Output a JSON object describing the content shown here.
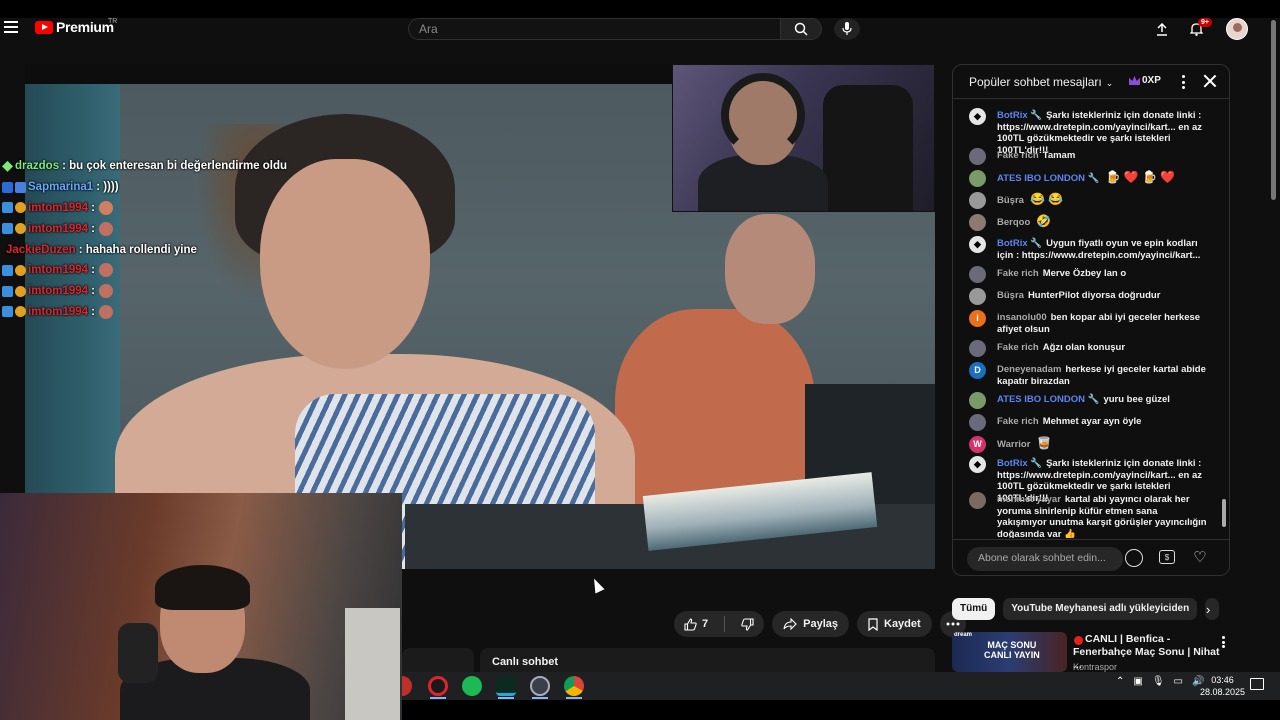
{
  "header": {
    "logo_text": "Premium",
    "logo_suffix": "TR",
    "search_placeholder": "Ara",
    "notification_count": "9+"
  },
  "overlay_chat": [
    {
      "user": "drazdos",
      "user_color": "#7fe87a",
      "message": ": bu çok enteresan bi değerlendirme oldu"
    },
    {
      "user": "Sapmarina1",
      "user_color": "#6aa6ff",
      "message": ": ))))"
    },
    {
      "user": "imtom1994",
      "user_color": "#e0242c",
      "message": ":"
    },
    {
      "user": "imtom1994",
      "user_color": "#e0242c",
      "message": ":"
    },
    {
      "user": "JackieDuzen",
      "user_color": "#e0242c",
      "message": ": hahaha rollendi yine"
    },
    {
      "user": "imtom1994",
      "user_color": "#e0242c",
      "message": ":"
    },
    {
      "user": "imtom1994",
      "user_color": "#e0242c",
      "message": ":"
    },
    {
      "user": "imtom1994",
      "user_color": "#e0242c",
      "message": ":"
    }
  ],
  "actions": {
    "like_count": "7",
    "share_label": "Paylaş",
    "save_label": "Kaydet"
  },
  "live_chat_label": "Canlı sohbet",
  "chat": {
    "title": "Popüler sohbet mesajları",
    "xp": "0XP",
    "input_placeholder": "Abone olarak sohbet edin...",
    "money_icon_label": "$",
    "messages": [
      {
        "name": "BotRix 🔧",
        "text": "Şarkı istekleriniz için donate linki : https://www.dretepin.com/yayinci/kart... en az 100TL gözükmektedir ve şarkı istekleri 100TL'dir!!!"
      },
      {
        "name": "Fake rich",
        "text": "Tamam"
      },
      {
        "name": "ATES IBO LONDON 🔧",
        "text": "🍺 ❤️ 🍺 ❤️"
      },
      {
        "name": "Büşra",
        "text": "😂 😂"
      },
      {
        "name": "Berqoo",
        "text": "🤣"
      },
      {
        "name": "BotRix 🔧",
        "text": "Uygun fiyatlı oyun ve epin kodları için : https://www.dretepin.com/yayinci/kart..."
      },
      {
        "name": "Fake rich",
        "text": "Merve Özbey lan o"
      },
      {
        "name": "Büşra",
        "text": "HunterPilot diyorsa doğrudur"
      },
      {
        "name": "insanolu00",
        "text": "ben kopar abi iyi geceler herkese afiyet olsun"
      },
      {
        "name": "Fake rich",
        "text": "Ağzı olan konuşur"
      },
      {
        "name": "Deneyenadam",
        "text": "herkese iyi geceler kartal abide kapatır birazdan"
      },
      {
        "name": "ATES IBO LONDON 🔧",
        "text": "yuru bee güzel"
      },
      {
        "name": "Fake rich",
        "text": "Mehmet ayar ayn öyle"
      },
      {
        "name": "Warrior",
        "text": "🥃"
      },
      {
        "name": "BotRix 🔧",
        "text": "Şarkı istekleriniz için donate linki : https://www.dretepin.com/yayinci/kart... en az 100TL gözükmektedir ve şarkı istekleri 100TL'dir!!!"
      },
      {
        "name": "mehmet yayar",
        "text": "kartal abi yayıncı olarak her yoruma sinirlenip küfür etmen sana yakışmıyor unutma karşıt görüşler yayıncılığın doğasında var 👍"
      }
    ]
  },
  "chips": [
    "Tümü",
    "YouTube Meyhanesi adlı yükleyiciden"
  ],
  "recommendation": {
    "thumb_label": "dream",
    "thumb_text": "MAÇ SONU\nCANLI YAYIN",
    "title": "CANLI | Benfica - Fenerbahçe Maç Sonu | Nihat ...",
    "channel": "Kontraspor"
  },
  "taskbar": {
    "time": "03:46",
    "date": "28.08.2025"
  },
  "colors": {
    "accent_red": "#ff0000",
    "bot_name_blue": "#5e84f1"
  }
}
